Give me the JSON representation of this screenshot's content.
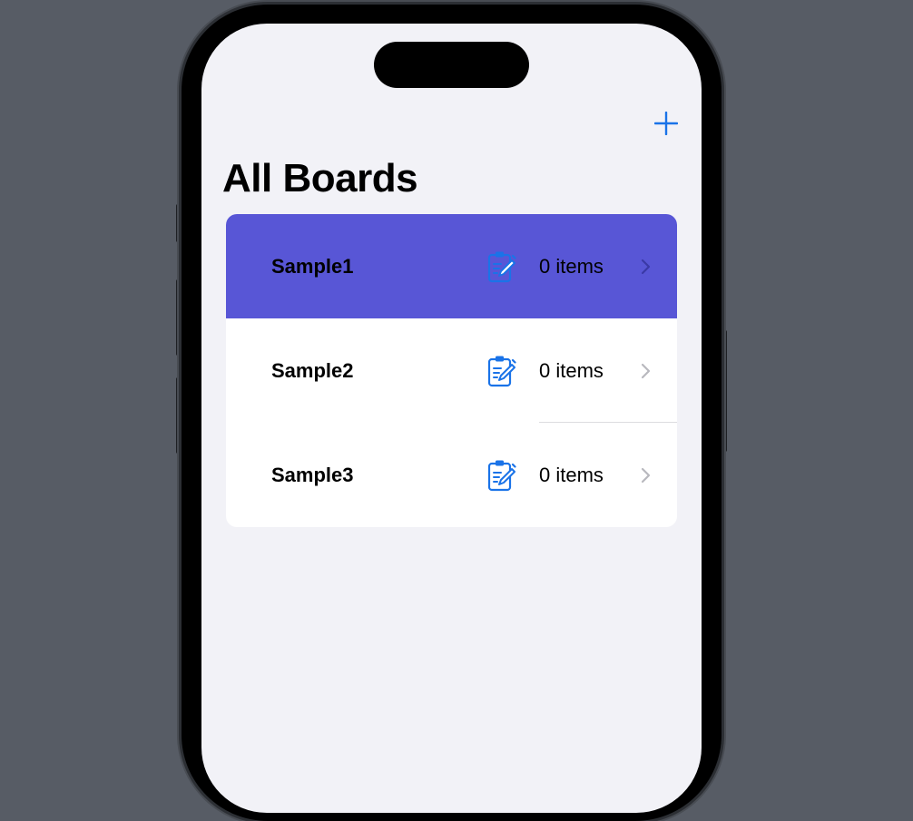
{
  "navigation": {
    "title": "All Boards",
    "add_icon": "plus-icon"
  },
  "boards": [
    {
      "name": "Sample1",
      "count": "0 items",
      "icon": "clipboard-pencil-icon",
      "selected": true
    },
    {
      "name": "Sample2",
      "count": "0 items",
      "icon": "clipboard-pencil-icon",
      "selected": false
    },
    {
      "name": "Sample3",
      "count": "0 items",
      "icon": "clipboard-pencil-icon",
      "selected": false
    }
  ],
  "colors": {
    "accent": "#1a73e8",
    "selected_row": "#5856d6",
    "background": "#f2f2f7",
    "chevron": "#b8b8be"
  }
}
